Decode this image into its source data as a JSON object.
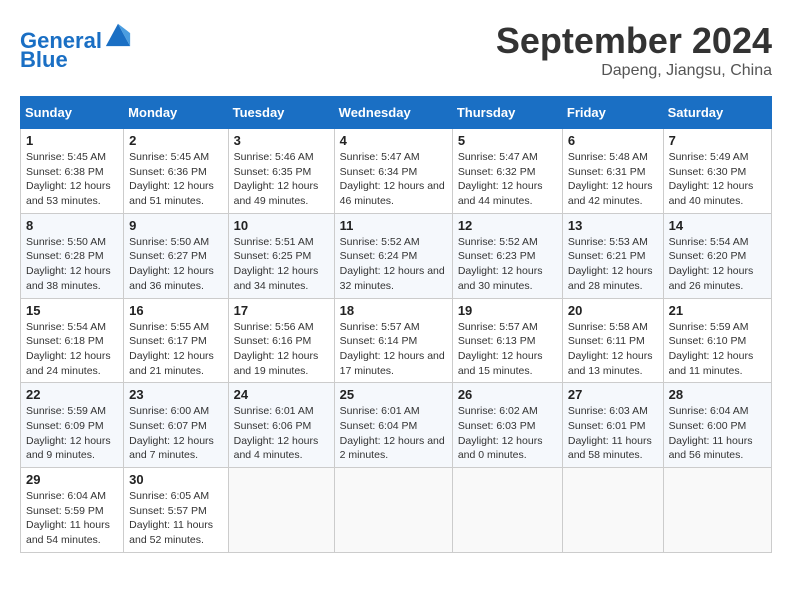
{
  "header": {
    "logo_line1": "General",
    "logo_line2": "Blue",
    "month": "September 2024",
    "location": "Dapeng, Jiangsu, China"
  },
  "weekdays": [
    "Sunday",
    "Monday",
    "Tuesday",
    "Wednesday",
    "Thursday",
    "Friday",
    "Saturday"
  ],
  "weeks": [
    [
      {
        "day": "1",
        "sunrise": "5:45 AM",
        "sunset": "6:38 PM",
        "daylight": "12 hours and 53 minutes."
      },
      {
        "day": "2",
        "sunrise": "5:45 AM",
        "sunset": "6:36 PM",
        "daylight": "12 hours and 51 minutes."
      },
      {
        "day": "3",
        "sunrise": "5:46 AM",
        "sunset": "6:35 PM",
        "daylight": "12 hours and 49 minutes."
      },
      {
        "day": "4",
        "sunrise": "5:47 AM",
        "sunset": "6:34 PM",
        "daylight": "12 hours and 46 minutes."
      },
      {
        "day": "5",
        "sunrise": "5:47 AM",
        "sunset": "6:32 PM",
        "daylight": "12 hours and 44 minutes."
      },
      {
        "day": "6",
        "sunrise": "5:48 AM",
        "sunset": "6:31 PM",
        "daylight": "12 hours and 42 minutes."
      },
      {
        "day": "7",
        "sunrise": "5:49 AM",
        "sunset": "6:30 PM",
        "daylight": "12 hours and 40 minutes."
      }
    ],
    [
      {
        "day": "8",
        "sunrise": "5:50 AM",
        "sunset": "6:28 PM",
        "daylight": "12 hours and 38 minutes."
      },
      {
        "day": "9",
        "sunrise": "5:50 AM",
        "sunset": "6:27 PM",
        "daylight": "12 hours and 36 minutes."
      },
      {
        "day": "10",
        "sunrise": "5:51 AM",
        "sunset": "6:25 PM",
        "daylight": "12 hours and 34 minutes."
      },
      {
        "day": "11",
        "sunrise": "5:52 AM",
        "sunset": "6:24 PM",
        "daylight": "12 hours and 32 minutes."
      },
      {
        "day": "12",
        "sunrise": "5:52 AM",
        "sunset": "6:23 PM",
        "daylight": "12 hours and 30 minutes."
      },
      {
        "day": "13",
        "sunrise": "5:53 AM",
        "sunset": "6:21 PM",
        "daylight": "12 hours and 28 minutes."
      },
      {
        "day": "14",
        "sunrise": "5:54 AM",
        "sunset": "6:20 PM",
        "daylight": "12 hours and 26 minutes."
      }
    ],
    [
      {
        "day": "15",
        "sunrise": "5:54 AM",
        "sunset": "6:18 PM",
        "daylight": "12 hours and 24 minutes."
      },
      {
        "day": "16",
        "sunrise": "5:55 AM",
        "sunset": "6:17 PM",
        "daylight": "12 hours and 21 minutes."
      },
      {
        "day": "17",
        "sunrise": "5:56 AM",
        "sunset": "6:16 PM",
        "daylight": "12 hours and 19 minutes."
      },
      {
        "day": "18",
        "sunrise": "5:57 AM",
        "sunset": "6:14 PM",
        "daylight": "12 hours and 17 minutes."
      },
      {
        "day": "19",
        "sunrise": "5:57 AM",
        "sunset": "6:13 PM",
        "daylight": "12 hours and 15 minutes."
      },
      {
        "day": "20",
        "sunrise": "5:58 AM",
        "sunset": "6:11 PM",
        "daylight": "12 hours and 13 minutes."
      },
      {
        "day": "21",
        "sunrise": "5:59 AM",
        "sunset": "6:10 PM",
        "daylight": "12 hours and 11 minutes."
      }
    ],
    [
      {
        "day": "22",
        "sunrise": "5:59 AM",
        "sunset": "6:09 PM",
        "daylight": "12 hours and 9 minutes."
      },
      {
        "day": "23",
        "sunrise": "6:00 AM",
        "sunset": "6:07 PM",
        "daylight": "12 hours and 7 minutes."
      },
      {
        "day": "24",
        "sunrise": "6:01 AM",
        "sunset": "6:06 PM",
        "daylight": "12 hours and 4 minutes."
      },
      {
        "day": "25",
        "sunrise": "6:01 AM",
        "sunset": "6:04 PM",
        "daylight": "12 hours and 2 minutes."
      },
      {
        "day": "26",
        "sunrise": "6:02 AM",
        "sunset": "6:03 PM",
        "daylight": "12 hours and 0 minutes."
      },
      {
        "day": "27",
        "sunrise": "6:03 AM",
        "sunset": "6:01 PM",
        "daylight": "11 hours and 58 minutes."
      },
      {
        "day": "28",
        "sunrise": "6:04 AM",
        "sunset": "6:00 PM",
        "daylight": "11 hours and 56 minutes."
      }
    ],
    [
      {
        "day": "29",
        "sunrise": "6:04 AM",
        "sunset": "5:59 PM",
        "daylight": "11 hours and 54 minutes."
      },
      {
        "day": "30",
        "sunrise": "6:05 AM",
        "sunset": "5:57 PM",
        "daylight": "11 hours and 52 minutes."
      },
      null,
      null,
      null,
      null,
      null
    ]
  ]
}
